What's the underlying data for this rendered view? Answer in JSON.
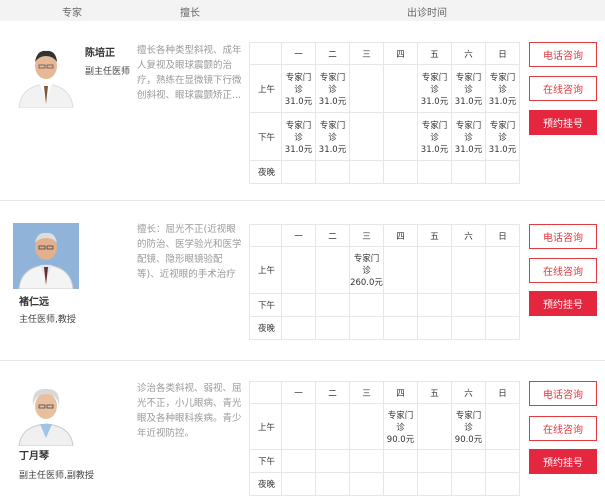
{
  "header": {
    "col_expert": "专家",
    "col_specialty": "擅长",
    "col_schedule": "出诊时间"
  },
  "weekdays": [
    "一",
    "二",
    "三",
    "四",
    "五",
    "六",
    "日"
  ],
  "periods": {
    "am": "上午",
    "pm": "下午",
    "night": "夜晚"
  },
  "buttons": {
    "phone": "电话咨询",
    "online": "在线咨询",
    "book": "预约挂号"
  },
  "doctors": [
    {
      "name": "陈培正",
      "title": "副主任医师",
      "specialty": "擅长各种类型斜视、成年人复视及眼球震颤的治疗，熟练在显微镜下行微创斜视、眼球震颤矫正...",
      "am": [
        [
          "专家门诊",
          "31.0元"
        ],
        [
          "专家门诊",
          "31.0元"
        ],
        null,
        null,
        [
          "专家门诊",
          "31.0元"
        ],
        [
          "专家门诊",
          "31.0元"
        ],
        [
          "专家门诊",
          "31.0元"
        ]
      ],
      "pm": [
        [
          "专家门诊",
          "31.0元"
        ],
        [
          "专家门诊",
          "31.0元"
        ],
        null,
        null,
        [
          "专家门诊",
          "31.0元"
        ],
        [
          "专家门诊",
          "31.0元"
        ],
        [
          "专家门诊",
          "31.0元"
        ]
      ]
    },
    {
      "name": "褚仁远",
      "title": "主任医师,教授",
      "specialty": "擅长：屈光不正(近视眼的防治、医学验光和医学配镜、隐形眼镜验配等)、近视眼的手术治疗(包括后...",
      "am": [
        null,
        null,
        [
          "专家门诊",
          "260.0元"
        ],
        null,
        null,
        null,
        null
      ],
      "pm": [
        null,
        null,
        null,
        null,
        null,
        null,
        null
      ]
    },
    {
      "name": "丁月琴",
      "title": "副主任医师,副教授",
      "specialty": "诊治各类斜视、弱视、屈光不正，小儿眼病、青光眼及各种眼科疾病。青少年近视防控。",
      "am": [
        null,
        null,
        null,
        [
          "专家门诊",
          "90.0元"
        ],
        null,
        [
          "专家门诊",
          "90.0元"
        ],
        null
      ],
      "pm": [
        null,
        null,
        null,
        null,
        null,
        null,
        null
      ]
    }
  ],
  "colors": {
    "accent": "#e5263f",
    "outline": "#e23a3f",
    "header_bg": "#f3f3f3",
    "border": "#e6e6e6"
  }
}
